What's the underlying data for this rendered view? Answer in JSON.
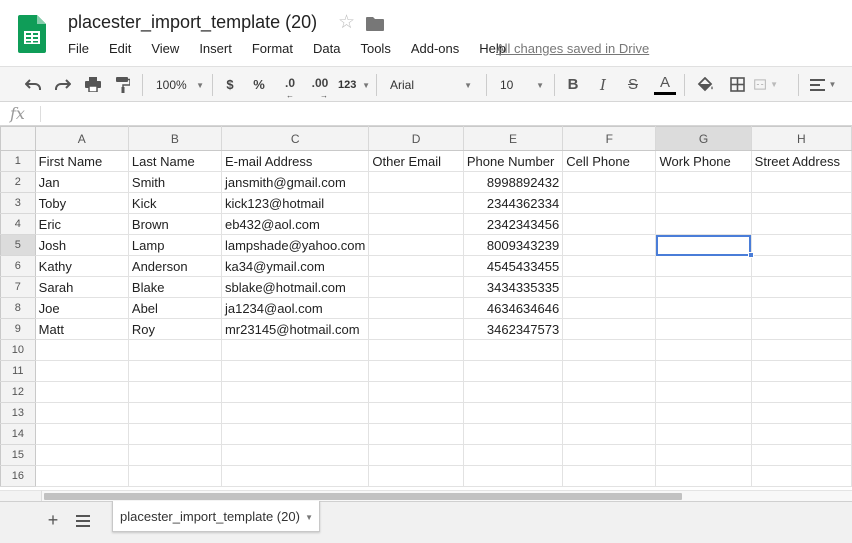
{
  "document": {
    "title": "placester_import_template (20)",
    "save_status": "All changes saved in Drive",
    "brand_color": "#0f9d58"
  },
  "menu": [
    "File",
    "Edit",
    "View",
    "Insert",
    "Format",
    "Data",
    "Tools",
    "Add-ons",
    "Help"
  ],
  "toolbar": {
    "zoom": "100%",
    "currency": "$",
    "percent": "%",
    "decrease_decimal": ".0",
    "increase_decimal": ".00",
    "more_formats": "123",
    "font": "Arial",
    "font_size": "10",
    "bold": "B",
    "italic": "I",
    "strikethrough": "S",
    "text_color_letter": "A",
    "text_color": "#000000",
    "icons": [
      "undo-icon",
      "redo-icon",
      "print-icon",
      "paint-format-icon",
      "fill-color-icon",
      "borders-icon",
      "merge-cells-icon",
      "align-left-icon"
    ]
  },
  "formula_bar": {
    "fx_label": "fx",
    "value": ""
  },
  "grid": {
    "columns": [
      "A",
      "B",
      "C",
      "D",
      "E",
      "F",
      "G",
      "H"
    ],
    "selected_column": "G",
    "row_numbers": [
      "1",
      "2",
      "3",
      "4",
      "5",
      "6",
      "7",
      "8",
      "9",
      "10",
      "11",
      "12",
      "13",
      "14",
      "15",
      "16"
    ],
    "selected_row": "5",
    "active_cell": "G5",
    "rows": [
      [
        "First Name",
        "Last Name",
        "E-mail Address",
        "Other Email",
        "Phone Number",
        "Cell Phone",
        "Work Phone",
        "Street Address"
      ],
      [
        "Jan",
        "Smith",
        "jansmith@gmail.com",
        "",
        "8998892432",
        "",
        "",
        ""
      ],
      [
        "Toby",
        "Kick",
        "kick123@hotmail",
        "",
        "2344362334",
        "",
        "",
        ""
      ],
      [
        "Eric",
        "Brown",
        "eb432@aol.com",
        "",
        "2342343456",
        "",
        "",
        ""
      ],
      [
        "Josh",
        "Lamp",
        "lampshade@yahoo.com",
        "",
        "8009343239",
        "",
        "",
        ""
      ],
      [
        "Kathy",
        "Anderson",
        "ka34@ymail.com",
        "",
        "4545433455",
        "",
        "",
        ""
      ],
      [
        "Sarah",
        "Blake",
        "sblake@hotmail.com",
        "",
        "3434335335",
        "",
        "",
        ""
      ],
      [
        "Joe",
        "Abel",
        "ja1234@aol.com",
        "",
        "4634634646",
        "",
        "",
        ""
      ],
      [
        "Matt",
        "Roy",
        "mr23145@hotmail.com",
        "",
        "3462347573",
        "",
        "",
        ""
      ],
      [
        "",
        "",
        "",
        "",
        "",
        "",
        "",
        ""
      ],
      [
        "",
        "",
        "",
        "",
        "",
        "",
        "",
        ""
      ],
      [
        "",
        "",
        "",
        "",
        "",
        "",
        "",
        ""
      ],
      [
        "",
        "",
        "",
        "",
        "",
        "",
        "",
        ""
      ],
      [
        "",
        "",
        "",
        "",
        "",
        "",
        "",
        ""
      ],
      [
        "",
        "",
        "",
        "",
        "",
        "",
        "",
        ""
      ],
      [
        "",
        "",
        "",
        "",
        "",
        "",
        "",
        ""
      ]
    ],
    "numeric_column": "E",
    "selection_color": "#4a7dd8"
  },
  "sheets": {
    "tabs": [
      "placester_import_template (20)"
    ],
    "active": "placester_import_template (20)",
    "add_label": "+"
  }
}
